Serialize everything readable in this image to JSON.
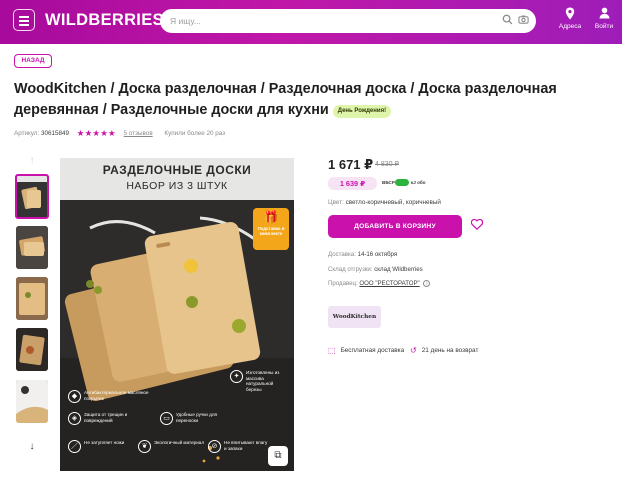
{
  "header": {
    "logo": "WILDBERRIES",
    "search_placeholder": "Я ищу...",
    "address_label": "Адреса",
    "login_label": "Войти",
    "accent": "#cb11ab"
  },
  "back_label": "НАЗАД",
  "product": {
    "title": "WoodKitchen / Доска разделочная / Разделочная доска / Доска разделочная деревянная / Разделочные доски для кухни",
    "badge": "День Рождения!",
    "article_label": "Артикул:",
    "article": "30615849",
    "rating_stars": "★★★★★",
    "rating": 5,
    "reviews": "5 отзывов",
    "bought": "Купили более 20 раз"
  },
  "image": {
    "title_line1": "РАЗДЕЛОЧНЫЕ ДОСКИ",
    "title_line2": "НАБОР ИЗ 3 ШТУК",
    "gift_text": "Подставка в комплекте",
    "features": {
      "birch": "Изготовлены из массива натуральной березы",
      "antibacterial": "Антибактериальное масляное покрытие",
      "cracks": "Защита от трещин и повреждений",
      "handles": "Удобные ручки для переноски",
      "knives": "Не затупляет ножи",
      "eco": "Экологичный материал",
      "odors": "Не впитывают влагу и запахи"
    }
  },
  "buy": {
    "price": "1 671 ₽",
    "old_price": "4 830 ₽",
    "wallet_price": "1 639 ₽",
    "sbp_label": "ВБСР",
    "sbp_note": "кЈ обо",
    "color_label": "Цвет:",
    "color_value": "светло-коричневый, коричневый",
    "cart_label": "ДОБАВИТЬ В КОРЗИНУ",
    "delivery_label": "Доставка:",
    "delivery_value": "14-16 октября",
    "warehouse_label": "Склад отгрузки:",
    "warehouse_value": "склад Wildberries",
    "seller_label": "Продавец:",
    "seller_value": "ООО \"РЕСТОРАТОР\"",
    "brand": "WoodKitchen",
    "free_delivery": "Бесплатная доставка",
    "return_days": "21 день на возврат"
  }
}
